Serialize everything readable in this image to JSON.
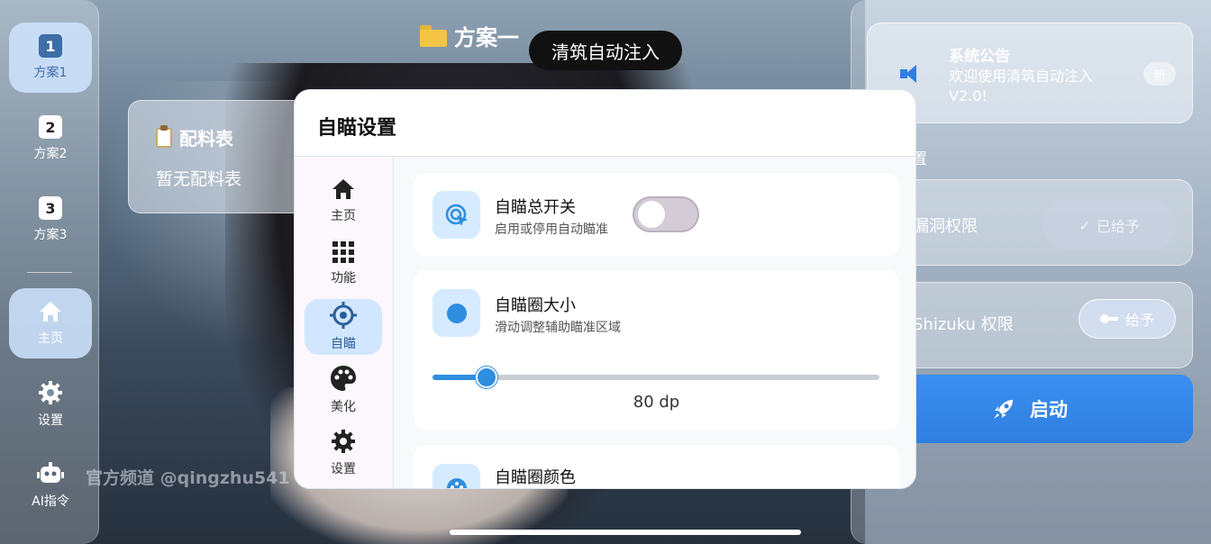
{
  "left_nav": {
    "items": [
      {
        "number": "1",
        "label": "方案1"
      },
      {
        "number": "2",
        "label": "方案2"
      },
      {
        "number": "3",
        "label": "方案3"
      },
      {
        "label": "主页"
      },
      {
        "label": "设置"
      },
      {
        "label": "AI指令"
      }
    ]
  },
  "header": {
    "plan_title": "方案一",
    "toast": "清筑自动注入"
  },
  "recipe": {
    "title": "配料表",
    "empty_text": "暂无配料表"
  },
  "right_panel": {
    "notice_title": "系统公告",
    "notice_body": "欢迎使用清筑自动注入V2.0!",
    "new_badge": "新",
    "settings_label": "置",
    "perm_vuln_label": "漏洞权限",
    "perm_vuln_button": "已给予",
    "perm_shizuku_label": "Shizuku 权限",
    "perm_shizuku_button": "给予",
    "launch_button": "启动"
  },
  "watermark": "官方频道 @qingzhu541",
  "dialog": {
    "title": "自瞄设置",
    "rail": [
      {
        "label": "主页",
        "icon": "home-icon"
      },
      {
        "label": "功能",
        "icon": "grid-icon"
      },
      {
        "label": "自瞄",
        "icon": "crosshair-icon"
      },
      {
        "label": "美化",
        "icon": "palette-icon"
      },
      {
        "label": "设置",
        "icon": "gear-icon"
      }
    ],
    "active_rail": "自瞄",
    "aim_switch": {
      "title": "自瞄总开关",
      "subtitle": "启用或停用自动瞄准",
      "enabled": false
    },
    "aim_size": {
      "title": "自瞄圈大小",
      "subtitle": "滑动调整辅助瞄准区域",
      "value_text": "80 dp",
      "value_fraction": 0.12
    },
    "aim_color": {
      "title": "自瞄圈颜色"
    }
  },
  "colors": {
    "accent": "#2f8ee0",
    "launch": "#2f7fe0",
    "active_tile": "#d2e6ff"
  }
}
